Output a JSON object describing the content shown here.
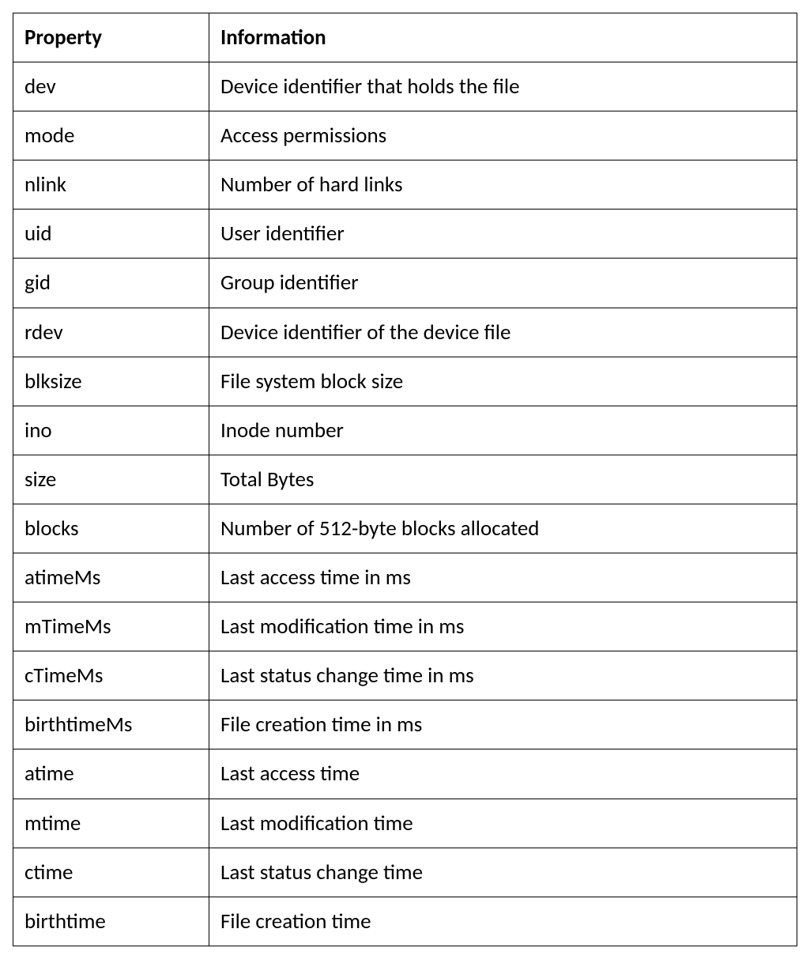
{
  "table": {
    "headers": {
      "col0": "Property",
      "col1": "Information"
    },
    "rows": [
      {
        "property": "dev",
        "info": "Device identifier that holds the file"
      },
      {
        "property": "mode",
        "info": "Access permissions"
      },
      {
        "property": "nlink",
        "info": "Number of hard links"
      },
      {
        "property": "uid",
        "info": "User identifier"
      },
      {
        "property": "gid",
        "info": "Group identifier"
      },
      {
        "property": "rdev",
        "info": "Device identifier of the device file"
      },
      {
        "property": "blksize",
        "info": "File system block size"
      },
      {
        "property": "ino",
        "info": "Inode number"
      },
      {
        "property": "size",
        "info": "Total Bytes"
      },
      {
        "property": "blocks",
        "info": "Number of 512-byte blocks allocated"
      },
      {
        "property": "atimeMs",
        "info": "Last access time in ms"
      },
      {
        "property": "mTimeMs",
        "info": "Last modification time in ms"
      },
      {
        "property": "cTimeMs",
        "info": "Last status change time in ms"
      },
      {
        "property": "birthtimeMs",
        "info": "File creation time in ms"
      },
      {
        "property": "atime",
        "info": "Last access time"
      },
      {
        "property": "mtime",
        "info": "Last modification time"
      },
      {
        "property": "ctime",
        "info": "Last status change time"
      },
      {
        "property": "birthtime",
        "info": "File creation time"
      }
    ]
  }
}
